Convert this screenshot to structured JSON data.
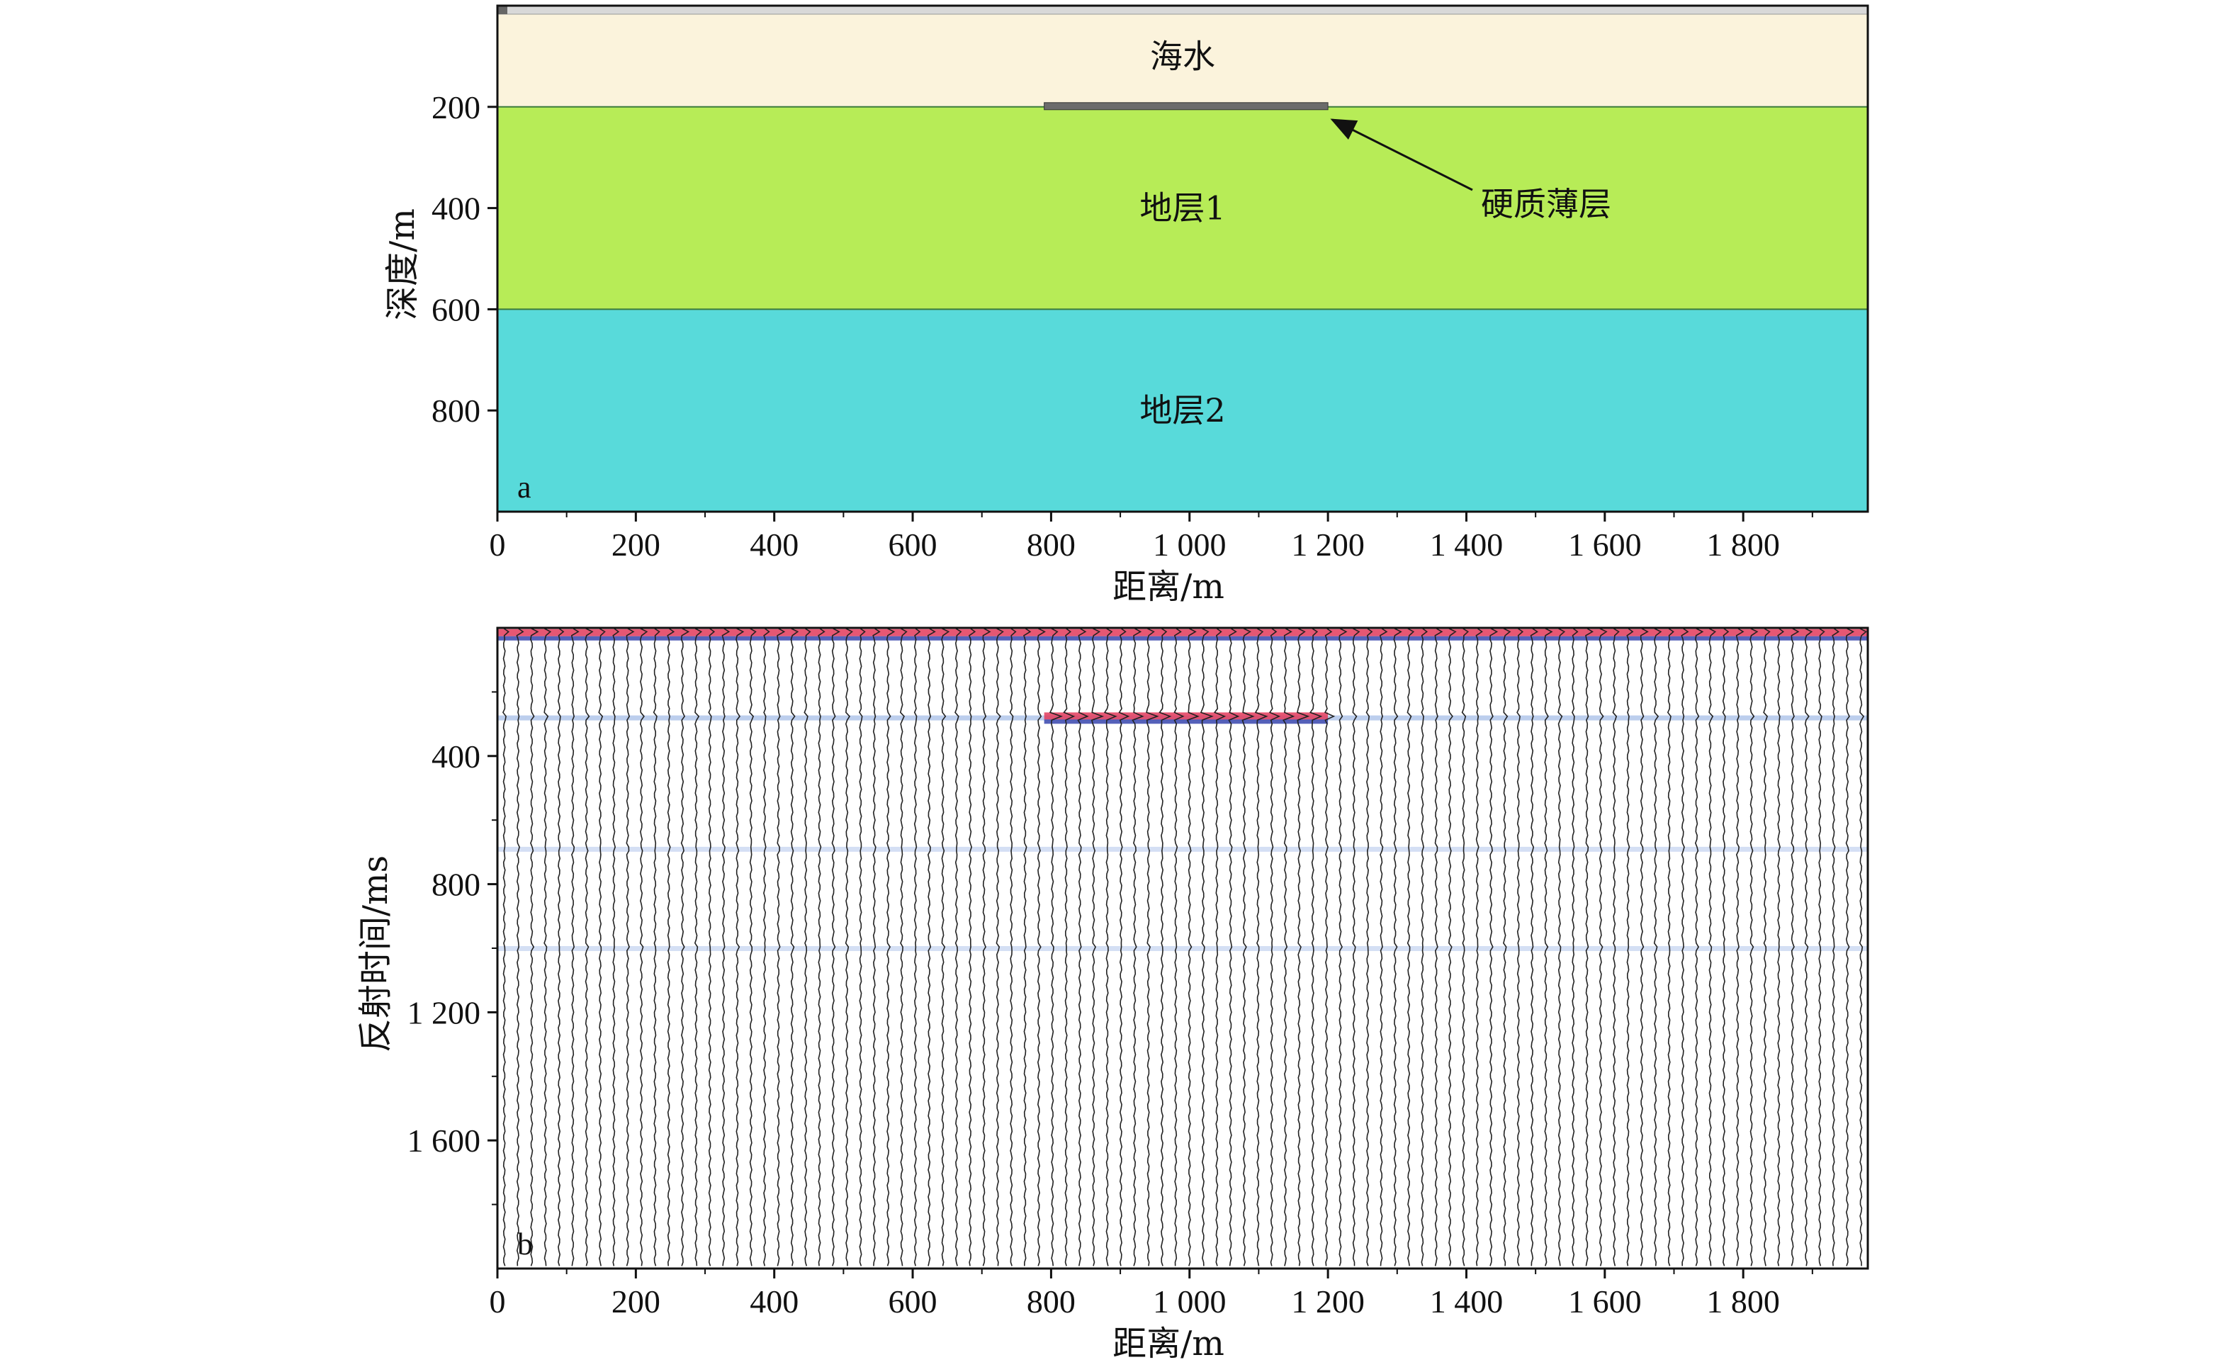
{
  "chart_data": [
    {
      "type": "area",
      "panel": "a",
      "xlabel": "距离/m",
      "ylabel": "深度/m",
      "xlim": [
        0,
        1980
      ],
      "ylim": [
        0,
        1000
      ],
      "y_inverted": true,
      "x_ticks": [
        {
          "value": 0,
          "label": "0"
        },
        {
          "value": 200,
          "label": "200"
        },
        {
          "value": 400,
          "label": "400"
        },
        {
          "value": 600,
          "label": "600"
        },
        {
          "value": 800,
          "label": "800"
        },
        {
          "value": 1000,
          "label": "1 000"
        },
        {
          "value": 1200,
          "label": "1 200"
        },
        {
          "value": 1400,
          "label": "1 400"
        },
        {
          "value": 1600,
          "label": "1 600"
        },
        {
          "value": 1800,
          "label": "1 800"
        }
      ],
      "y_ticks": [
        {
          "value": 200,
          "label": "200"
        },
        {
          "value": 400,
          "label": "400"
        },
        {
          "value": 600,
          "label": "600"
        },
        {
          "value": 800,
          "label": "800"
        }
      ],
      "layers": [
        {
          "name": "海水",
          "top": 0,
          "bottom": 200,
          "color": "#fbf3dc"
        },
        {
          "name": "地层1",
          "top": 200,
          "bottom": 600,
          "color": "#b7ec57"
        },
        {
          "name": "地层2",
          "top": 600,
          "bottom": 1000,
          "color": "#58dada"
        }
      ],
      "thin_layer": {
        "x_start": 790,
        "x_end": 1200,
        "depth": 200,
        "color": "#6b6b6b"
      },
      "annotation": {
        "text": "硬质薄层",
        "arrow_target": [
          1200,
          200
        ]
      },
      "panel_label": "a"
    },
    {
      "type": "line",
      "panel": "b",
      "xlabel": "距离/m",
      "ylabel": "反射时间/ms",
      "xlim": [
        0,
        1980
      ],
      "ylim": [
        0,
        2000
      ],
      "y_inverted": true,
      "x_ticks": [
        {
          "value": 0,
          "label": "0"
        },
        {
          "value": 200,
          "label": "200"
        },
        {
          "value": 400,
          "label": "400"
        },
        {
          "value": 600,
          "label": "600"
        },
        {
          "value": 800,
          "label": "800"
        },
        {
          "value": 1000,
          "label": "1 000"
        },
        {
          "value": 1200,
          "label": "1 200"
        },
        {
          "value": 1400,
          "label": "1 400"
        },
        {
          "value": 1600,
          "label": "1 600"
        },
        {
          "value": 1800,
          "label": "1 800"
        }
      ],
      "y_ticks": [
        {
          "value": 400,
          "label": "400"
        },
        {
          "value": 800,
          "label": "800"
        },
        {
          "value": 1200,
          "label": "1 200"
        },
        {
          "value": 1600,
          "label": "1 600"
        }
      ],
      "trace_count": 100,
      "reflections": [
        {
          "time": 15,
          "x_start": 0,
          "x_end": 1980,
          "strength": "strong"
        },
        {
          "time": 280,
          "x_start": 0,
          "x_end": 1980,
          "strength": "weak"
        },
        {
          "time": 275,
          "x_start": 790,
          "x_end": 1200,
          "strength": "strong"
        },
        {
          "time": 690,
          "x_start": 0,
          "x_end": 1980,
          "strength": "faint"
        },
        {
          "time": 1000,
          "x_start": 0,
          "x_end": 1980,
          "strength": "faint"
        }
      ],
      "panel_label": "b"
    }
  ]
}
